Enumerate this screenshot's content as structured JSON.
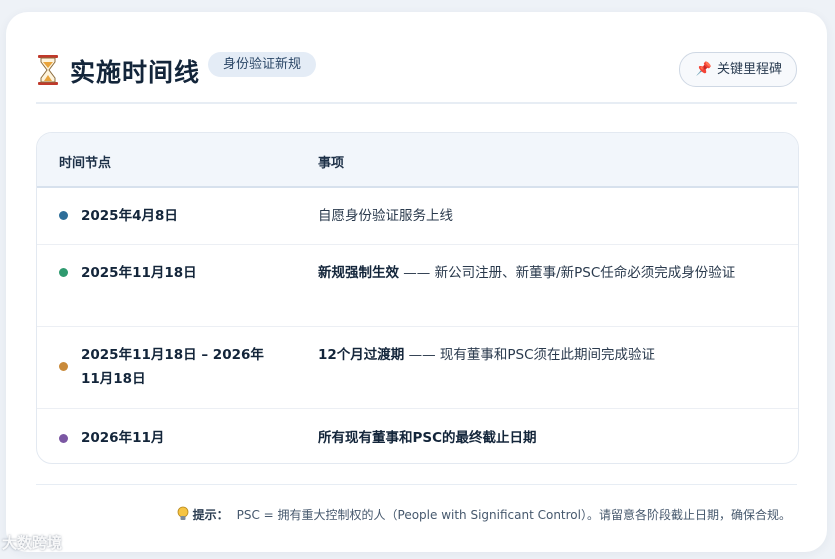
{
  "header": {
    "title": "实施时间线",
    "badge": "身份验证新规",
    "milestone_button": "关键里程碑"
  },
  "table": {
    "col_time": "时间节点",
    "col_item": "事项",
    "rows": [
      {
        "date": "2025年4月8日",
        "bold": "",
        "text": "自愿身份验证服务上线",
        "dot_color": "#2e6e99"
      },
      {
        "date": "2025年11月18日",
        "bold": "新规强制生效",
        "text": " —— 新公司注册、新董事/新PSC任命必须完成身份验证",
        "dot_color": "#2f9a6f"
      },
      {
        "date": "2025年11月18日 – 2026年11月18日",
        "bold": "12个月过渡期",
        "text": " —— 现有董事和PSC须在此期间完成验证",
        "dot_color": "#c98a3a"
      },
      {
        "date": "2026年11月",
        "bold": "所有现有董事和PSC的最终截止日期",
        "text": "",
        "dot_color": "#7b57a3"
      }
    ]
  },
  "footer": {
    "hint_label": "提示：",
    "hint_text": "PSC = 拥有重大控制权的人（People with Significant Control）。请留意各阶段截止日期，确保合规。"
  },
  "watermark": "大数跨境"
}
